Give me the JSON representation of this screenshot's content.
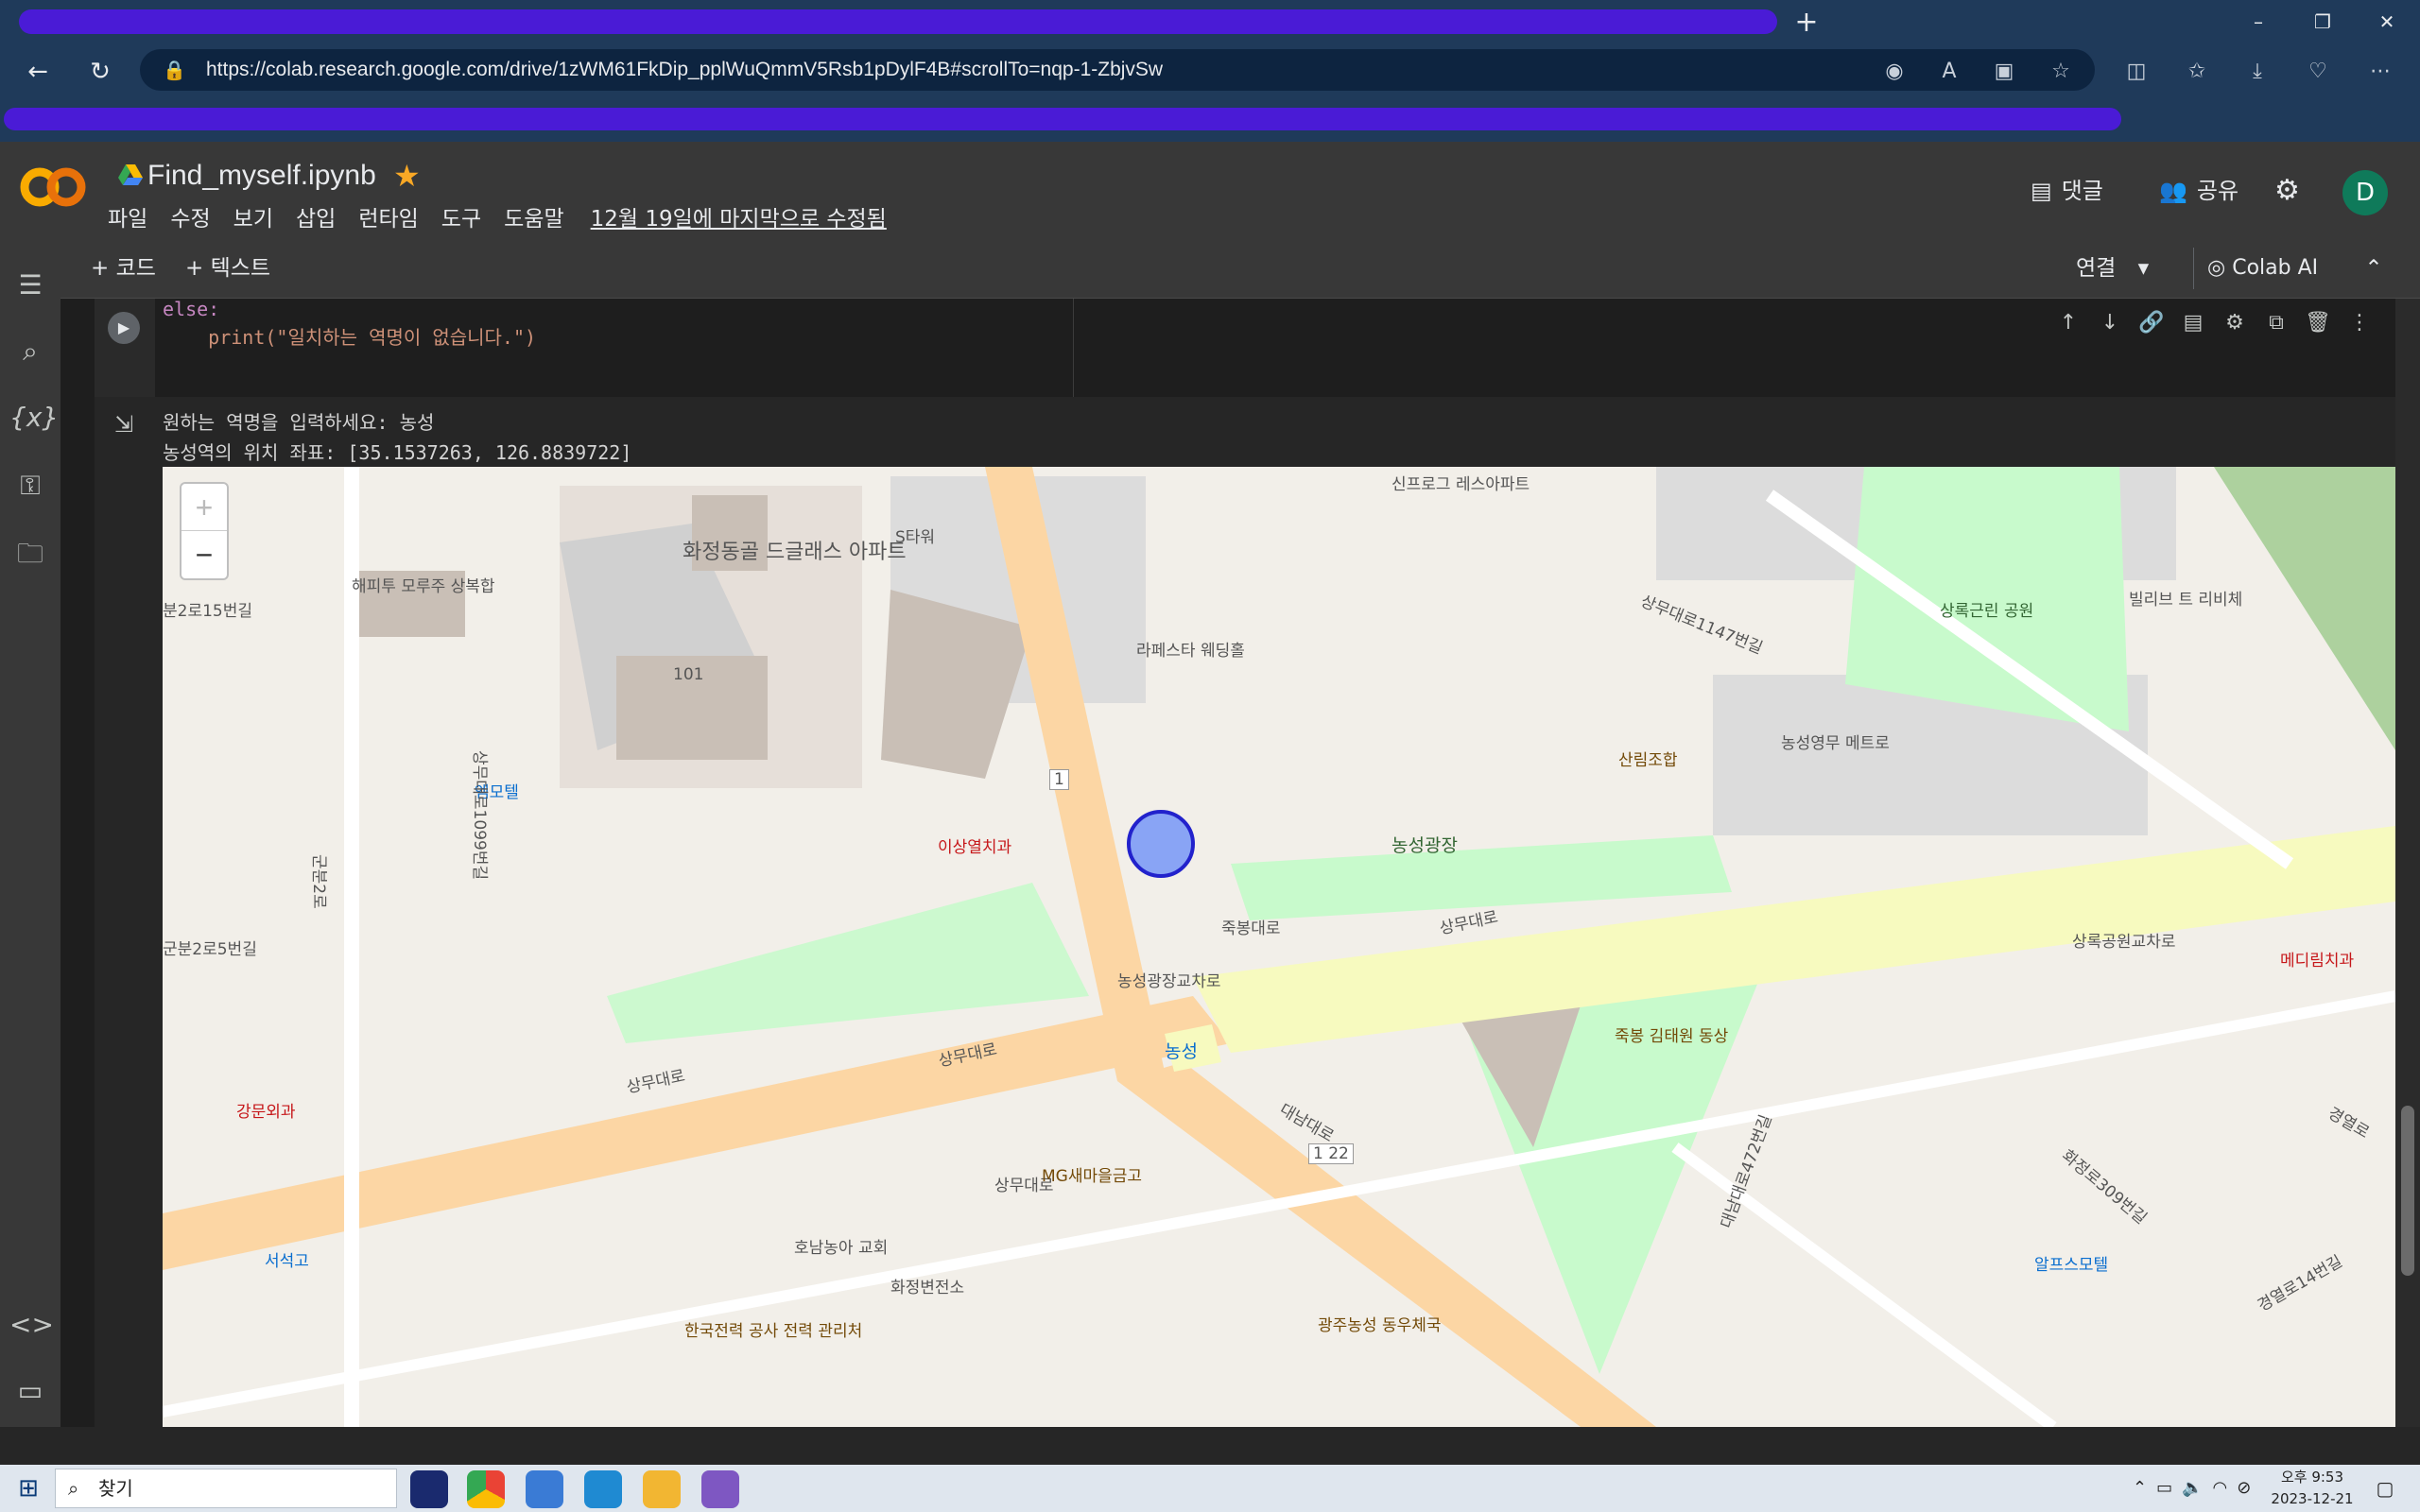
{
  "browser": {
    "url": "https://colab.research.google.com/drive/1zWM61FkDip_pplWuQmmV5Rsb1pDylF4B#scrollTo=nqp-1-ZbjvSw",
    "new_tab_icon": "plus-icon",
    "win_minimize": "–",
    "win_restore": "❐",
    "win_close": "✕"
  },
  "colab": {
    "notebook_title": "Find_myself.ipynb",
    "menu": [
      "파일",
      "수정",
      "보기",
      "삽입",
      "런타임",
      "도구",
      "도움말"
    ],
    "last_edit": "12월 19일에 마지막으로 수정됨",
    "comment_label": "댓글",
    "share_label": "공유",
    "avatar_letter": "D",
    "add_code": "+ 코드",
    "add_text": "+ 텍스트",
    "connect_label": "연결",
    "colab_ai_label": "Colab AI",
    "accent_orange": "#f9ab00",
    "logo_color": "#f9ab00"
  },
  "code_cell": {
    "line1": "else:",
    "line2": "    print(\"일치하는 역명이 없습니다.\")"
  },
  "output": {
    "line1": "원하는 역명을 입력하세요: 농성",
    "line2": "농성역의 위치 좌표: [35.1537263, 126.8839722]"
  },
  "map": {
    "zoom_in": "+",
    "zoom_out": "−",
    "labels": [
      "화정동골 드글래스 아파트",
      "S타워",
      "101",
      "해피투 모루주 상복합",
      "분2로15번길",
      "엠모텔",
      "상무대로1099번길",
      "군분2로",
      "군분2로5번길",
      "이상열치과",
      "라페스타 웨딩홀",
      "신프로그 레스아파트",
      "상무대로1147번길",
      "상록근린 공원",
      "빌리브 트 리비체",
      "산림조합",
      "농성영무 메트로",
      "농성광장",
      "죽봉대로",
      "상무대로",
      "농성광장교차로",
      "농성",
      "상록공원교차로",
      "메디림치과",
      "경열로",
      "강문외과",
      "서석고",
      "MG새마을금고",
      "호남농아 교회",
      "화정변전소",
      "한국전력 공사 전력 관리처",
      "대남대로",
      "죽봉 김태원 동상",
      "대남대로472번길",
      "화정로309번길",
      "알프스모텔",
      "경열로14번길",
      "광주농성 동우체국",
      "1",
      "1 22"
    ]
  },
  "taskbar": {
    "search_placeholder": "찾기",
    "clock_time": "오후 9:53",
    "clock_date": "2023-12-21"
  }
}
